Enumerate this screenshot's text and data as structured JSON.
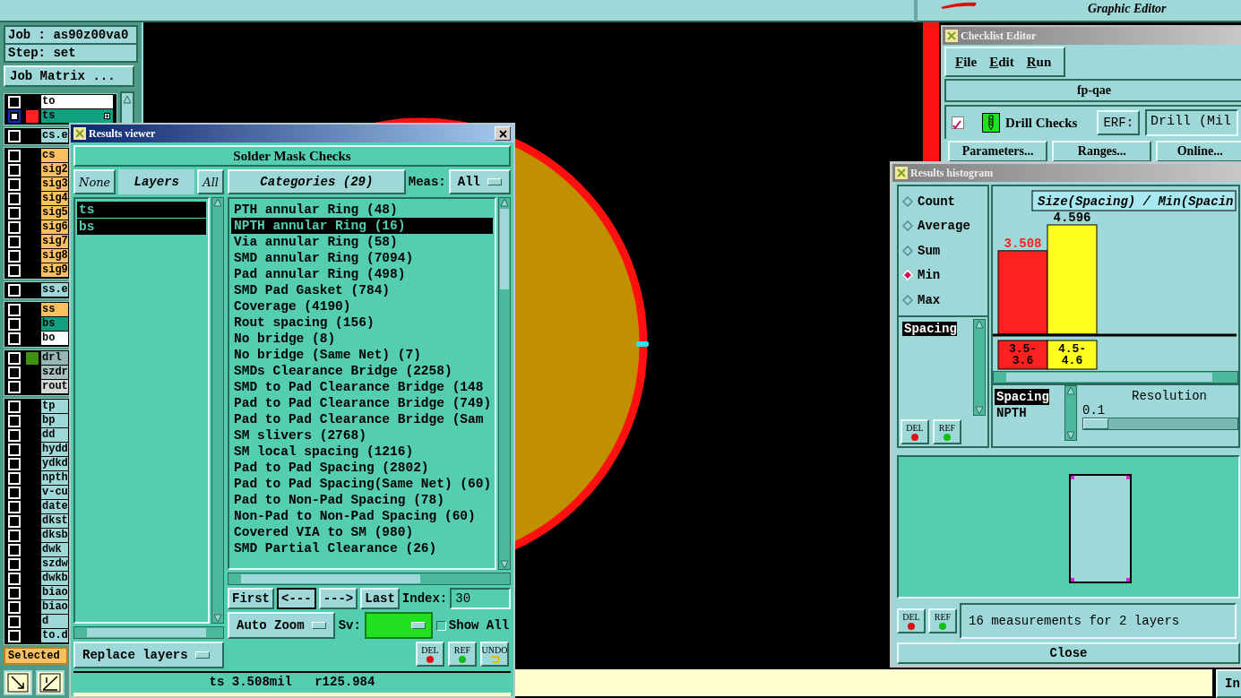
{
  "top_bar": {
    "subtitle": "Graphic Editor"
  },
  "job_panel": {
    "job": "Job : as90z00va0",
    "step": "Step: set",
    "matrix_button": "Job Matrix ...",
    "layer_groups": [
      [
        {
          "name": "to",
          "color": "#ffffff",
          "selected": false
        },
        {
          "name": "ts",
          "color": "#10a080",
          "swatch": {
            "color": "#ff2020"
          },
          "selected": true
        }
      ],
      [
        {
          "name": "cs.e",
          "color": "#9ed8d8",
          "selected": false
        }
      ],
      [
        {
          "name": "cs",
          "color": "#f8c060",
          "selected": false
        },
        {
          "name": "sig2",
          "color": "#f8c060",
          "selected": false
        },
        {
          "name": "sig3",
          "color": "#f8c060",
          "selected": false
        },
        {
          "name": "sig4",
          "color": "#f8c060",
          "selected": false
        },
        {
          "name": "sig5",
          "color": "#f8c060",
          "selected": false
        },
        {
          "name": "sig6",
          "color": "#f8c060",
          "selected": false
        },
        {
          "name": "sig7",
          "color": "#f8c060",
          "selected": false
        },
        {
          "name": "sig8",
          "color": "#f8c060",
          "selected": false
        },
        {
          "name": "sig9",
          "color": "#f8c060",
          "selected": false
        }
      ],
      [
        {
          "name": "ss.e",
          "color": "#9ed8d8",
          "selected": false
        }
      ],
      [
        {
          "name": "ss",
          "color": "#f8c060",
          "selected": false
        },
        {
          "name": "bs",
          "color": "#10a080",
          "selected": false
        },
        {
          "name": "bo",
          "color": "#ffffff",
          "selected": false
        }
      ],
      [
        {
          "name": "drl",
          "color": "#98b8b8",
          "swatch": {
            "color": "#409010"
          },
          "selected": false
        },
        {
          "name": "szdr",
          "color": "#a8c0c0",
          "selected": false
        },
        {
          "name": "rout",
          "color": "#d0d8d8",
          "selected": false
        }
      ],
      [
        {
          "name": "tp",
          "color": "#9ed8d8",
          "selected": false
        },
        {
          "name": "bp",
          "color": "#9ed8d8",
          "selected": false
        },
        {
          "name": "dd",
          "color": "#9ed8d8",
          "selected": false
        },
        {
          "name": "hydd",
          "color": "#9ed8d8",
          "selected": false
        },
        {
          "name": "ydkd",
          "color": "#9ed8d8",
          "selected": false
        },
        {
          "name": "npth",
          "color": "#9ed8d8",
          "selected": false
        },
        {
          "name": "v-cu",
          "color": "#9ed8d8",
          "selected": false
        },
        {
          "name": "date",
          "color": "#9ed8d8",
          "selected": false
        },
        {
          "name": "dkst",
          "color": "#9ed8d8",
          "selected": false
        },
        {
          "name": "dksb",
          "color": "#9ed8d8",
          "selected": false
        },
        {
          "name": "dwk",
          "color": "#9ed8d8",
          "selected": false
        },
        {
          "name": "szdw",
          "color": "#9ed8d8",
          "selected": false
        },
        {
          "name": "dwkb",
          "color": "#9ed8d8",
          "selected": false
        },
        {
          "name": "biao",
          "color": "#9ed8d8",
          "selected": false
        },
        {
          "name": "biao",
          "color": "#9ed8d8",
          "selected": false
        },
        {
          "name": "d",
          "color": "#9ed8d8",
          "selected": false
        },
        {
          "name": "to.d",
          "color": "#9ed8d8",
          "selected": false
        }
      ]
    ],
    "selected_label": "Selected"
  },
  "results_viewer": {
    "title": "Results viewer",
    "header": "Solder Mask Checks",
    "none_button": "None",
    "layers_label": "Layers",
    "all_button": "All",
    "layers": [
      {
        "name": "ts",
        "selected": true
      },
      {
        "name": "bs",
        "selected": true
      }
    ],
    "replace_dropdown": "Replace layers",
    "categories_button": "Categories (29)",
    "meas_label": "Meas:",
    "meas_value": "All",
    "categories": [
      {
        "label": "PTH annular Ring (48)",
        "selected": false
      },
      {
        "label": "NPTH annular Ring (16)",
        "selected": true
      },
      {
        "label": "Via annular Ring (58)",
        "selected": false
      },
      {
        "label": "SMD annular Ring (7094)",
        "selected": false
      },
      {
        "label": "Pad annular Ring (498)",
        "selected": false
      },
      {
        "label": "SMD Pad Gasket (784)",
        "selected": false
      },
      {
        "label": "Coverage (4190)",
        "selected": false
      },
      {
        "label": "Rout spacing (156)",
        "selected": false
      },
      {
        "label": "No bridge (8)",
        "selected": false
      },
      {
        "label": "No bridge (Same Net) (7)",
        "selected": false
      },
      {
        "label": "SMDs Clearance Bridge (2258)",
        "selected": false
      },
      {
        "label": "SMD to Pad Clearance Bridge (148",
        "selected": false
      },
      {
        "label": "Pad to Pad Clearance Bridge (749)",
        "selected": false
      },
      {
        "label": "Pad to Pad Clearance Bridge (Sam",
        "selected": false
      },
      {
        "label": "SM slivers (2768)",
        "selected": false
      },
      {
        "label": "SM local spacing (1216)",
        "selected": false
      },
      {
        "label": "Pad to Pad Spacing (2802)",
        "selected": false
      },
      {
        "label": "Pad to Pad Spacing(Same Net) (60)",
        "selected": false
      },
      {
        "label": "Pad to Non-Pad Spacing (78)",
        "selected": false
      },
      {
        "label": "Non-Pad to Non-Pad Spacing (60)",
        "selected": false
      },
      {
        "label": "Covered VIA to SM (980)",
        "selected": false
      },
      {
        "label": "SMD Partial Clearance (26)",
        "selected": false
      }
    ],
    "nav": [
      {
        "label": "First",
        "selected": false
      },
      {
        "label": "<---",
        "selected": true
      },
      {
        "label": "--->",
        "selected": false
      },
      {
        "label": "Last",
        "selected": false
      }
    ],
    "index_label": "Index:",
    "index_value": "30",
    "zoom_dropdown": "Auto Zoom",
    "sv_label": "Sv:",
    "show_all": {
      "label": "Show All",
      "checked": false
    },
    "tool_buttons": [
      {
        "label": "DEL",
        "kind": "del"
      },
      {
        "label": "REF",
        "kind": "ref"
      },
      {
        "label": "UNDO",
        "kind": "undo"
      }
    ],
    "status": "ts 3.508mil   r125.984"
  },
  "checklist_editor": {
    "title": "Checklist Editor",
    "menu": [
      "File",
      "Edit",
      "Run"
    ],
    "checklist_name": "fp-qae",
    "check": {
      "label": "Drill Checks",
      "checked": true
    },
    "erf_label": "ERF:",
    "erf_value": "Drill (Mil",
    "buttons": [
      "Parameters...",
      "Ranges...",
      "Online..."
    ]
  },
  "histogram": {
    "title": "Results histogram",
    "modes": [
      {
        "label": "Count",
        "selected": false
      },
      {
        "label": "Average",
        "selected": false
      },
      {
        "label": "Sum",
        "selected": false
      },
      {
        "label": "Min",
        "selected": true
      },
      {
        "label": "Max",
        "selected": false
      }
    ],
    "measures": [
      {
        "label": "Spacing",
        "selected": true
      }
    ],
    "side_buttons": [
      {
        "label": "DEL",
        "kind": "del"
      },
      {
        "label": "REF",
        "kind": "ref"
      }
    ],
    "chart_data": {
      "type": "bar",
      "title": "Size(Spacing) / Min(Spacin",
      "categories": [
        "3.5-3.6",
        "4.5-4.6"
      ],
      "stacked": true,
      "data_labels": true,
      "series": [
        {
          "color": "#ff2020",
          "values": [
            3.508,
            null
          ]
        },
        {
          "color": "#ffff20",
          "values": [
            null,
            4.596
          ]
        }
      ]
    },
    "types": [
      {
        "label": "Spacing",
        "selected": true
      },
      {
        "label": "NPTH",
        "selected": false
      }
    ],
    "resolution_label": "Resolution",
    "resolution_value": "0.1",
    "resolution_slider": {
      "level": 0
    },
    "bottom_buttons": [
      {
        "label": "DEL",
        "kind": "del"
      },
      {
        "label": "REF",
        "kind": "ref"
      }
    ],
    "summary": "16 measurements for 2 layers",
    "close_button": "Close"
  },
  "bottom_bar": {
    "button": "In"
  }
}
